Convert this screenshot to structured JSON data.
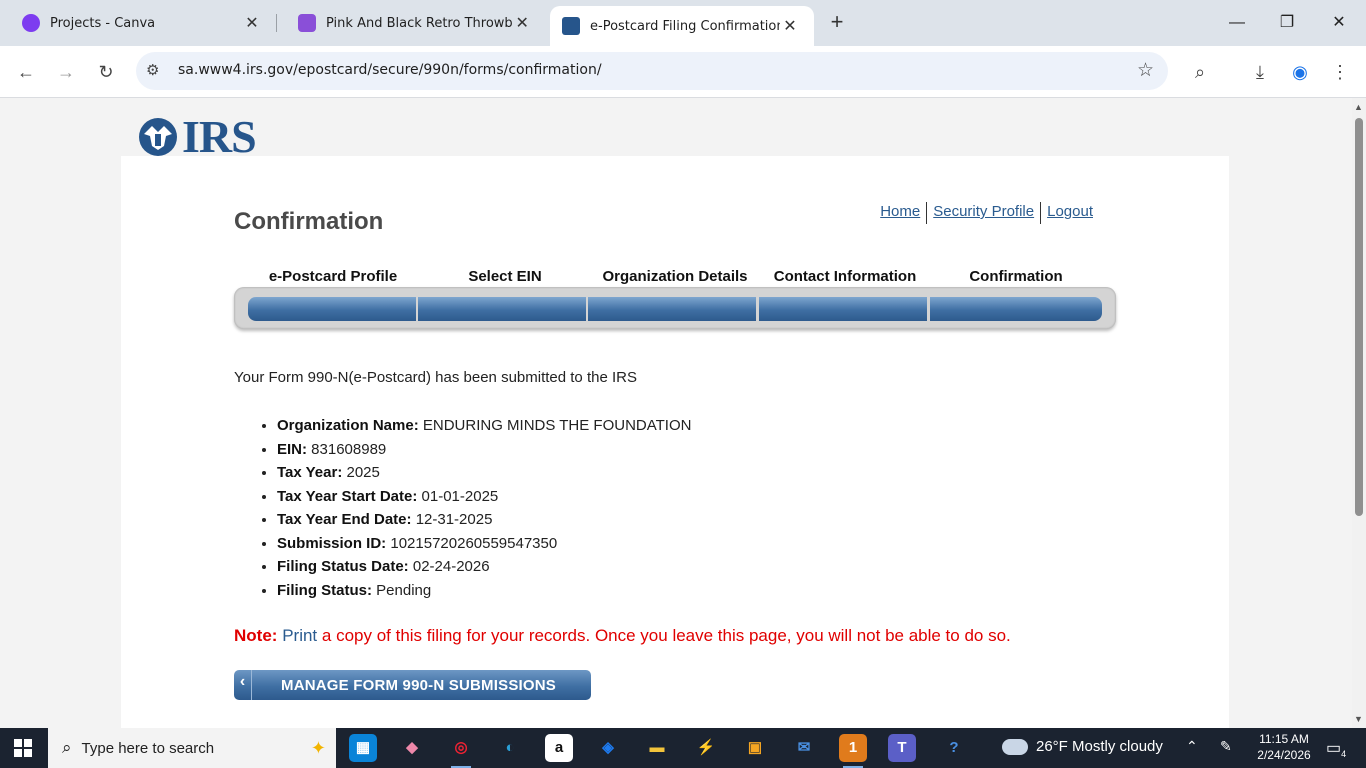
{
  "browser": {
    "tabs": [
      {
        "title": "Projects - Canva",
        "favicon_color": "#7d3cf0"
      },
      {
        "title": "Pink And Black Retro Throwback",
        "favicon_color": "#8a4fd8"
      },
      {
        "title": "e-Postcard Filing Confirmation",
        "favicon_color": "#26558b"
      }
    ],
    "url": "sa.www4.irs.gov/epostcard/secure/990n/forms/confirmation/"
  },
  "page": {
    "logo_text": "IRS",
    "title": "Confirmation",
    "nav": {
      "home": "Home",
      "security_profile": "Security Profile",
      "logout": "Logout"
    },
    "steps": [
      "e-Postcard Profile",
      "Select EIN",
      "Organization Details",
      "Contact Information",
      "Confirmation"
    ],
    "progress_completed_steps": 5,
    "intro": "Your Form 990-N(e-Postcard) has been submitted to the IRS",
    "details": [
      {
        "label": "Organization Name:",
        "value": "ENDURING MINDS THE FOUNDATION"
      },
      {
        "label": "EIN:",
        "value": "831608989"
      },
      {
        "label": "Tax Year:",
        "value": "2025"
      },
      {
        "label": "Tax Year Start Date:",
        "value": "01-01-2025"
      },
      {
        "label": "Tax Year End Date:",
        "value": "12-31-2025"
      },
      {
        "label": "Submission ID:",
        "value": "10215720260559547350"
      },
      {
        "label": "Filing Status Date:",
        "value": "02-24-2026"
      },
      {
        "label": "Filing Status:",
        "value": "Pending"
      }
    ],
    "note": {
      "label": "Note:",
      "link": "Print",
      "text": "a copy of this filing for your records. Once you leave this page, you will not be able to do so."
    },
    "manage_button": "MANAGE FORM 990-N SUBMISSIONS",
    "accent_color": "#2a5b8f",
    "note_color": "#e00000"
  },
  "taskbar": {
    "search_placeholder": "Type here to search",
    "weather": "26°F  Mostly cloudy",
    "time": "11:15 AM",
    "date": "2/24/2026",
    "notification_count": "4",
    "icons": [
      "edge-icon",
      "file-explorer-icon",
      "chrome-icon",
      "amazon-icon",
      "dropbox-icon",
      "folder-icon",
      "store-icon",
      "mail-icon",
      "app-icon",
      "teams-icon",
      "help-icon"
    ]
  }
}
